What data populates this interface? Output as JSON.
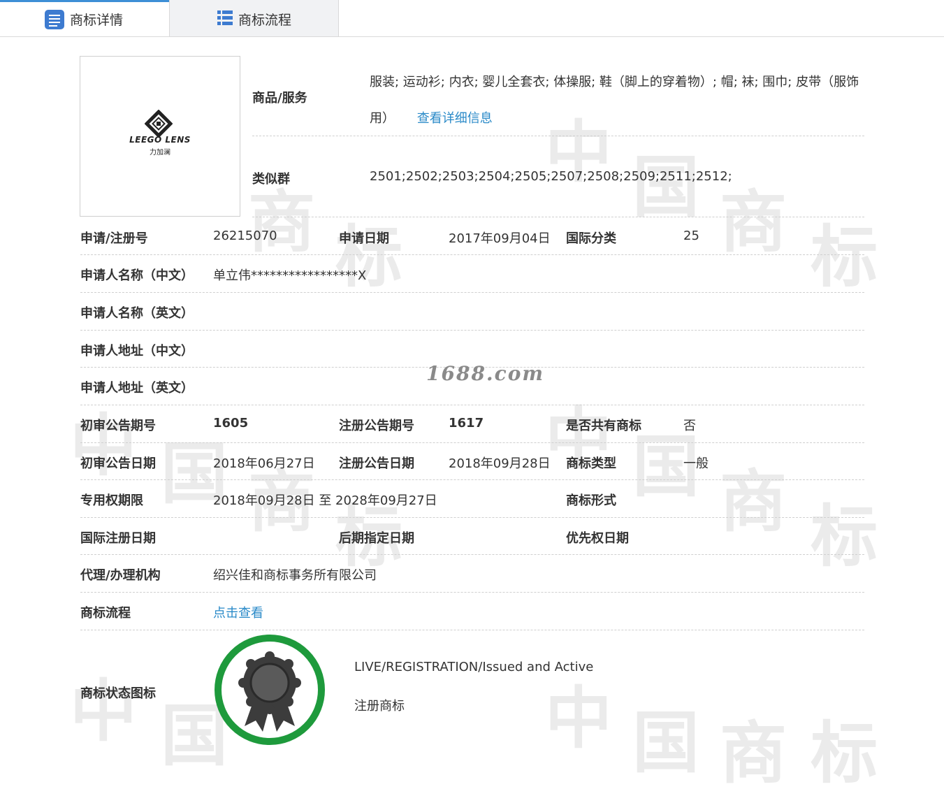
{
  "tabs": [
    {
      "label": "商标详情",
      "active": true,
      "icon": "list-icon"
    },
    {
      "label": "商标流程",
      "active": false,
      "icon": "table-icon"
    }
  ],
  "watermark": {
    "text": "1688.com",
    "chars": [
      "中",
      "国",
      "商",
      "标"
    ]
  },
  "logo": {
    "brand_text": "LEEGO LENS",
    "brand_sub": "力加澜"
  },
  "goods": {
    "label": "商品/服务",
    "value": "服装; 运动衫; 内衣; 婴儿全套衣; 体操服; 鞋（脚上的穿着物）; 帽; 袜; 围巾; 皮带（服饰用）",
    "link": "查看详细信息"
  },
  "similar": {
    "label": "类似群",
    "value": "2501;2502;2503;2504;2505;2507;2508;2509;2511;2512;"
  },
  "rows": {
    "reg_no": {
      "label": "申请/注册号",
      "value": "26215070"
    },
    "apply_date": {
      "label": "申请日期",
      "value": "2017年09月04日"
    },
    "intl_class": {
      "label": "国际分类",
      "value": "25"
    },
    "applicant_cn": {
      "label": "申请人名称（中文）",
      "value": "单立伟*****************X"
    },
    "applicant_en": {
      "label": "申请人名称（英文）",
      "value": ""
    },
    "address_cn": {
      "label": "申请人地址（中文）",
      "value": ""
    },
    "address_en": {
      "label": "申请人地址（英文）",
      "value": ""
    },
    "prelim_issue": {
      "label": "初审公告期号",
      "value": "1605"
    },
    "reg_issue": {
      "label": "注册公告期号",
      "value": "1617"
    },
    "shared": {
      "label": "是否共有商标",
      "value": "否"
    },
    "prelim_date": {
      "label": "初审公告日期",
      "value": "2018年06月27日"
    },
    "reg_date": {
      "label": "注册公告日期",
      "value": "2018年09月28日"
    },
    "tm_type": {
      "label": "商标类型",
      "value": "一般"
    },
    "exclusive": {
      "label": "专用权期限",
      "value": "2018年09月28日 至 2028年09月27日"
    },
    "tm_form": {
      "label": "商标形式",
      "value": ""
    },
    "intl_reg_date": {
      "label": "国际注册日期",
      "value": ""
    },
    "later_date": {
      "label": "后期指定日期",
      "value": ""
    },
    "priority_date": {
      "label": "优先权日期",
      "value": ""
    },
    "agency": {
      "label": "代理/办理机构",
      "value": "绍兴佳和商标事务所有限公司"
    },
    "flow": {
      "label": "商标流程",
      "value": "点击查看"
    }
  },
  "status": {
    "label": "商标状态图标",
    "line1": "LIVE/REGISTRATION/Issued and Active",
    "line2": "注册商标",
    "icon": "award-ribbon-icon",
    "ring_color": "#1e9a3c",
    "medal_color": "#3c3c3c"
  }
}
